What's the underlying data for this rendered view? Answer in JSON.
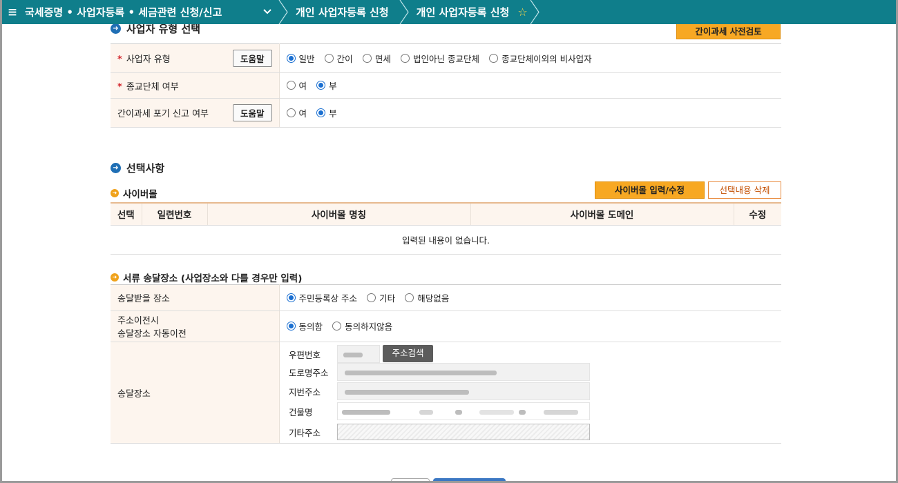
{
  "nav": {
    "menu_glyph": "≡",
    "main_menu": "국세증명 • 사업자등록 • 세금관련 신청/신고",
    "crumb_1": "개인 사업자등록 신청",
    "crumb_2": "개인 사업자등록 신청"
  },
  "section1": {
    "title": "사업자 유형 선택",
    "precheck_button": "간이과세 사전검토",
    "rows": [
      {
        "label": "사업자 유형",
        "required": true,
        "help": "도움말",
        "options": [
          "일반",
          "간이",
          "면세",
          "법인아닌 종교단체",
          "종교단체이외의 비사업자"
        ],
        "selected": 0
      },
      {
        "label": "종교단체 여부",
        "required": true,
        "options": [
          "여",
          "부"
        ],
        "selected": 1
      },
      {
        "label": "간이과세 포기 신고 여부",
        "required": false,
        "help": "도움말",
        "options": [
          "여",
          "부"
        ],
        "selected": 1
      }
    ]
  },
  "section2": {
    "title": "선택사항",
    "cybermall": {
      "title": "사이버몰",
      "input_button": "사이버몰 입력/수정",
      "delete_button": "선택내용 삭제",
      "columns": [
        "선택",
        "일련번호",
        "사이버몰 명칭",
        "사이버몰 도메인",
        "수정"
      ],
      "empty_text": "입력된 내용이 없습니다."
    },
    "delivery": {
      "title": "서류 송달장소 (사업장소와 다를 경우만 입력)",
      "rows": [
        {
          "label": "송달받을 장소",
          "options": [
            "주민등록상 주소",
            "기타",
            "해당없음"
          ],
          "selected": 0
        },
        {
          "label_line1": "주소이전시",
          "label_line2": "송달장소 자동이전",
          "options": [
            "동의함",
            "동의하지않음"
          ],
          "selected": 0
        }
      ],
      "place_label": "송달장소",
      "fields": {
        "postcode": "우편번호",
        "search_button": "주소검색",
        "road": "도로명주소",
        "lot": "지번주소",
        "building": "건물명",
        "etc": "기타주소"
      }
    }
  }
}
